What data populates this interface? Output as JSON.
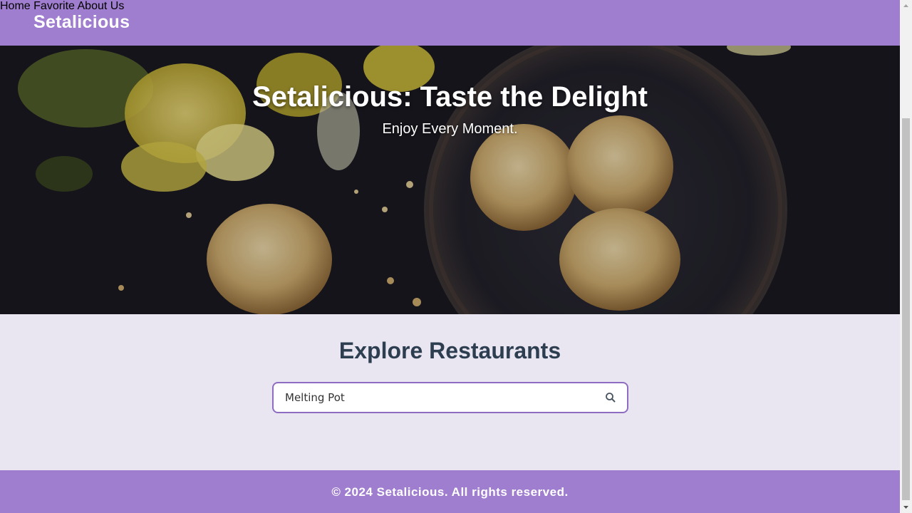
{
  "header": {
    "brand": "Setalicious",
    "nav": [
      {
        "label": "Home"
      },
      {
        "label": "Favorite"
      },
      {
        "label": "About Us"
      }
    ]
  },
  "hero": {
    "title": "Setalicious: Taste the Delight",
    "subtitle": "Enjoy Every Moment."
  },
  "explore": {
    "title": "Explore Restaurants",
    "search_value": "Melting Pot",
    "search_icon": "search-icon"
  },
  "footer": {
    "text": "© 2024 Setalicious. All rights reserved."
  },
  "colors": {
    "brand": "#a07ecf",
    "page_bg": "#e9e6f2",
    "heading": "#2d3e50",
    "search_border": "#8e6cc2"
  }
}
